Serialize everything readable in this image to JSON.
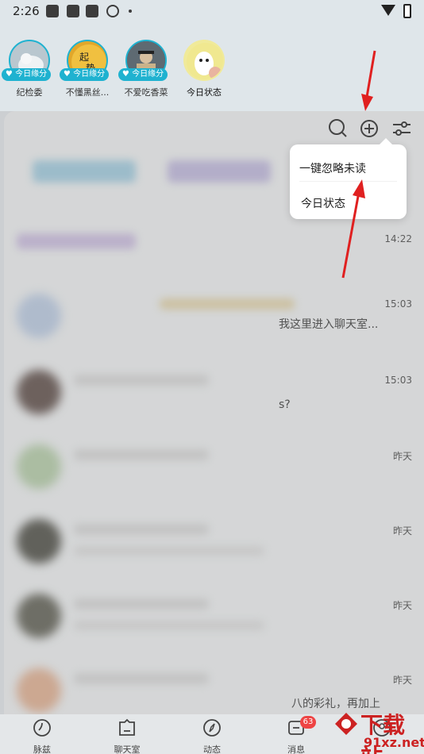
{
  "status_bar": {
    "time": "2:26"
  },
  "stories": [
    {
      "name": "纪检委",
      "tag": "今日缘分"
    },
    {
      "name": "不懂黑丝...",
      "tag": "今日缘分"
    },
    {
      "name": "不爱吃香菜",
      "tag": "今日缘分"
    },
    {
      "name": "今日状态",
      "tag": ""
    }
  ],
  "conversations": [
    {
      "time": ""
    },
    {
      "time": "14:22"
    },
    {
      "time": "15:03",
      "excerpt": "我这里进入聊天室..."
    },
    {
      "time": "15:03",
      "excerpt": "s?"
    },
    {
      "time": "昨天"
    },
    {
      "time": "昨天"
    },
    {
      "time": "昨天"
    },
    {
      "time": "昨天",
      "excerpt": "八的彩礼，再加上"
    }
  ],
  "popup_menu": [
    {
      "label": "一键忽略未读"
    },
    {
      "label": "今日状态"
    }
  ],
  "bottom_nav": [
    {
      "label": "脉兹"
    },
    {
      "label": "聊天室"
    },
    {
      "label": "动态"
    },
    {
      "label": "消息",
      "badge": "63"
    },
    {
      "label": ""
    }
  ],
  "watermark": {
    "text": "下载站",
    "url": "91xz.net"
  },
  "colors": {
    "accent": "#1fb2d0",
    "arrow": "#e02020"
  }
}
